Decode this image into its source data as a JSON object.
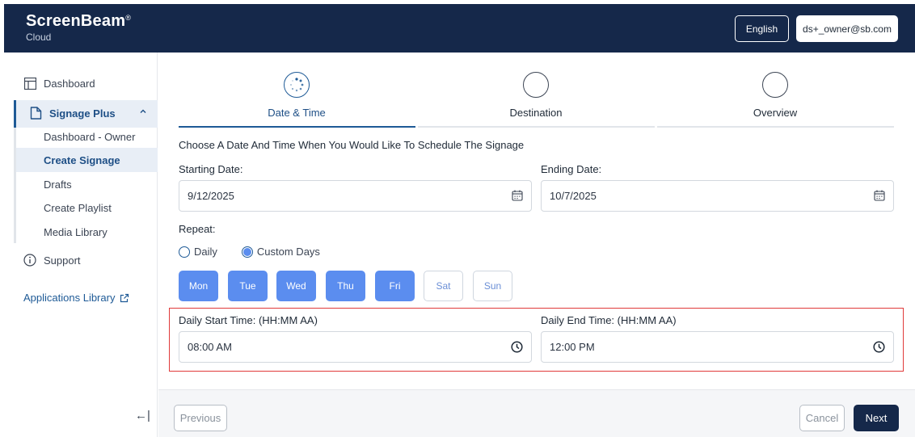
{
  "header": {
    "brand_name": "ScreenBeam",
    "brand_mark": "®",
    "brand_sub": "Cloud",
    "language": "English",
    "user_email": "ds+_owner@sb.com"
  },
  "sidebar": {
    "dashboard": "Dashboard",
    "group_label": "Signage Plus",
    "group_caret": "^",
    "sub_items": [
      "Dashboard - Owner",
      "Create Signage",
      "Drafts",
      "Create Playlist",
      "Media Library"
    ],
    "active_sub_item": "Create Signage",
    "support": "Support",
    "applications_library": "Applications Library",
    "collapse_glyph": "←|"
  },
  "stepper": {
    "steps": [
      "Date & Time",
      "Destination",
      "Overview"
    ],
    "active_step": "Date & Time"
  },
  "form": {
    "intro": "Choose A Date And Time When You Would Like To Schedule The Signage",
    "starting_date_label": "Starting Date:",
    "starting_date_value": "9/12/2025",
    "ending_date_label": "Ending Date:",
    "ending_date_value": "10/7/2025",
    "repeat_label": "Repeat:",
    "repeat_options": [
      "Daily",
      "Custom Days"
    ],
    "repeat_selected": "Custom Days",
    "days": [
      "Mon",
      "Tue",
      "Wed",
      "Thu",
      "Fri",
      "Sat",
      "Sun"
    ],
    "days_selected": [
      "Mon",
      "Tue",
      "Wed",
      "Thu",
      "Fri"
    ],
    "daily_start_label": "Daily Start Time: (HH:MM AA)",
    "daily_start_value": "08:00 AM",
    "daily_end_label": "Daily End Time: (HH:MM AA)",
    "daily_end_value": "12:00 PM"
  },
  "footer": {
    "previous": "Previous",
    "cancel": "Cancel",
    "next": "Next"
  },
  "colors": {
    "navy": "#15284a",
    "accent": "#1e5a96",
    "day_selected": "#5b8def",
    "highlight": "#e03a3a"
  }
}
